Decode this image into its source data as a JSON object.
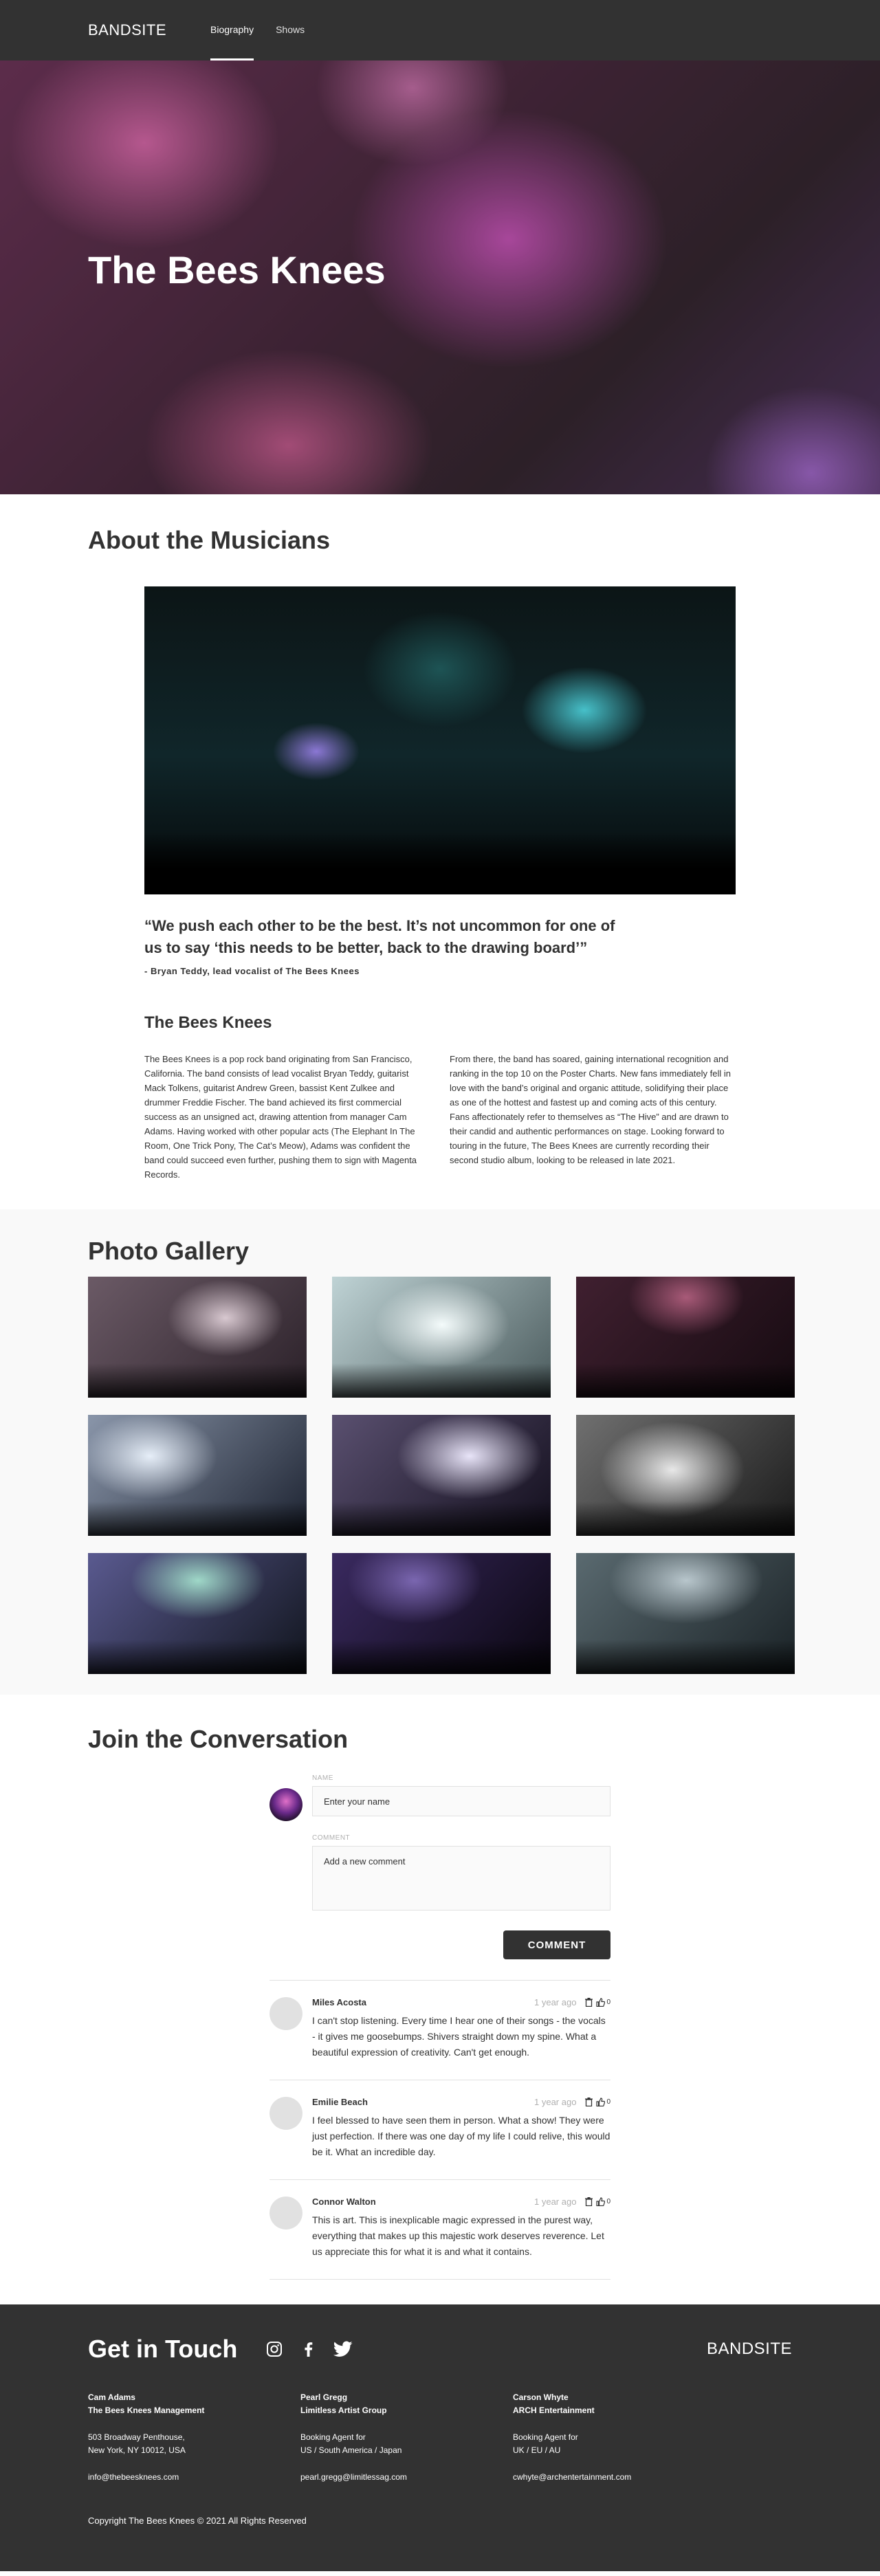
{
  "nav": {
    "logo": "BANDSITE",
    "links": [
      {
        "label": "Biography"
      },
      {
        "label": "Shows"
      }
    ]
  },
  "hero": {
    "title": "The Bees Knees"
  },
  "about": {
    "title": "About the Musicians",
    "quote": "“We push each other to be the best. It’s not uncommon for one of us to say ‘this needs to be better, back to the drawing board’”",
    "quote_author": "- Bryan Teddy, lead vocalist of The Bees Knees",
    "bio_title": "The Bees Knees",
    "bio_left": "The Bees Knees is a pop rock band originating from San Francisco, California. The band consists of lead vocalist Bryan Teddy, guitarist Mack Tolkens, guitarist Andrew Green, bassist Kent Zulkee and drummer Freddie Fischer. The band achieved its first commercial success as an unsigned act, drawing attention from manager Cam Adams. Having worked with other popular acts (The Elephant In The Room, One Trick Pony, The Cat’s Meow), Adams was confident the band could succeed even further, pushing them to sign with Magenta Records.",
    "bio_right": "From there, the band has soared, gaining international recognition and ranking in the top 10 on the Poster Charts. New fans immediately fell in love with the band’s original and organic attitude, solidifying their place as one of the hottest and fastest up and coming acts of this century. Fans affectionately refer to themselves as “The Hive” and are drawn to their candid and authentic performances on stage. Looking forward to touring in the future, The Bees Knees are currently recording their second studio album, looking to be released in late 2021."
  },
  "gallery": {
    "title": "Photo Gallery"
  },
  "conversation": {
    "title": "Join the Conversation",
    "name_label": "NAME",
    "name_placeholder": "Enter your name",
    "comment_label": "COMMENT",
    "comment_placeholder": "Add a new comment",
    "button_label": "COMMENT",
    "comments": [
      {
        "name": "Miles Acosta",
        "date": "1 year ago",
        "likes": "0",
        "text": "I can't stop listening. Every time I hear one of their songs - the vocals - it gives me goosebumps. Shivers straight down my spine. What a beautiful expression of creativity. Can't get enough."
      },
      {
        "name": "Emilie Beach",
        "date": "1 year ago",
        "likes": "0",
        "text": "I feel blessed to have seen them in person. What a show! They were just perfection. If there was one day of my life I could relive, this would be it. What an incredible day."
      },
      {
        "name": "Connor Walton",
        "date": "1 year ago",
        "likes": "0",
        "text": "This is art. This is inexplicable magic expressed in the purest way, everything that makes up this majestic work deserves reverence. Let us appreciate this for what it is and what it contains."
      }
    ]
  },
  "footer": {
    "title": "Get in Touch",
    "logo": "BANDSITE",
    "contacts": [
      {
        "name": "Cam Adams",
        "org": "The Bees Knees Management",
        "line1": "503 Broadway Penthouse,",
        "line2": "New York, NY 10012, USA",
        "email": "info@thebeesknees.com"
      },
      {
        "name": "Pearl Gregg",
        "org": "Limitless Artist Group",
        "line1": "Booking Agent for",
        "line2": "US / South America / Japan",
        "email": "pearl.gregg@limitlessag.com"
      },
      {
        "name": "Carson Whyte",
        "org": "ARCH Entertainment",
        "line1": "Booking Agent for",
        "line2": "UK / EU / AU",
        "email": "cwhyte@archentertainment.com"
      }
    ],
    "copyright": "Copyright The Bees Knees © 2021 All Rights Reserved"
  }
}
